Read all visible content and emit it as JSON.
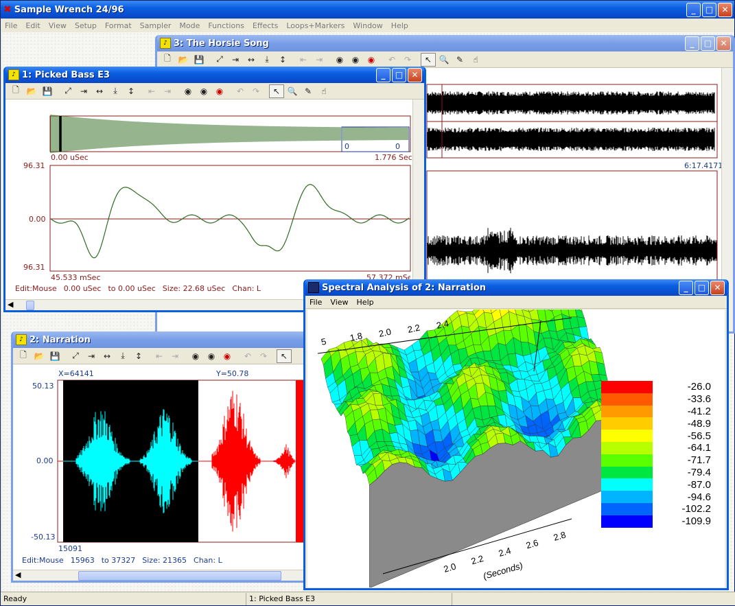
{
  "app": {
    "title": "Sample Wrench 24/96",
    "menu": [
      "File",
      "Edit",
      "View",
      "Setup",
      "Format",
      "Sampler",
      "Mode",
      "Functions",
      "Effects",
      "Loops+Markers",
      "Window",
      "Help"
    ],
    "status_left": "Ready",
    "status_right": "1:  Picked Bass E3"
  },
  "horsie": {
    "title": "3:  The Horsie Song",
    "time_end": "6:17.4171"
  },
  "bass": {
    "title": "1:  Picked Bass E3",
    "overview_start": "0.00 uSec",
    "overview_end": "1.776 Sec",
    "loop_marker_a": "0",
    "loop_marker_b": "0",
    "y_top": "96.31",
    "y_mid": "0.00",
    "y_bottom": "96.31",
    "time_left": "45.533 mSec",
    "time_right": "57.372 mSec",
    "status": {
      "edit": "Edit:Mouse",
      "from": "0.00 uSec",
      "to": "to 0.00 uSec",
      "size": "Size: 22.68 uSec",
      "chan": "Chan: L"
    }
  },
  "narration": {
    "title": "2:  Narration",
    "x_readout": "X=64141",
    "y_readout": "Y=50.78",
    "y_top": "50.13",
    "y_mid": "0.00",
    "y_bottom": "-50.13",
    "sample_left": "15091",
    "status": {
      "edit": "Edit:Mouse",
      "from": "15963",
      "to": "to 37327",
      "size": "Size: 21365",
      "chan": "Chan: L"
    }
  },
  "spectral": {
    "title": "Spectral Analysis of  2:  Narration",
    "menu": [
      "File",
      "View",
      "Help"
    ],
    "top_axis_ticks": [
      "5",
      "1.8",
      "2.0",
      "2.2",
      "2.4"
    ],
    "bottom_axis_ticks": [
      "2.0",
      "2.2",
      "2.4",
      "2.6",
      "2.8"
    ],
    "bottom_axis_label": "(Seconds)",
    "legend": [
      {
        "value": "-26.0",
        "color": "#ff0000"
      },
      {
        "value": "-33.6",
        "color": "#ff5a00"
      },
      {
        "value": "-41.2",
        "color": "#ff9b00"
      },
      {
        "value": "-48.9",
        "color": "#ffcc00"
      },
      {
        "value": "-56.5",
        "color": "#ffff00"
      },
      {
        "value": "-64.1",
        "color": "#b8ff00"
      },
      {
        "value": "-71.7",
        "color": "#5aff00"
      },
      {
        "value": "-79.4",
        "color": "#00e640"
      },
      {
        "value": "-87.0",
        "color": "#00ffff"
      },
      {
        "value": "-94.6",
        "color": "#00b4ff"
      },
      {
        "value": "-102.2",
        "color": "#0064ff"
      },
      {
        "value": "-109.9",
        "color": "#0000ff"
      }
    ]
  }
}
